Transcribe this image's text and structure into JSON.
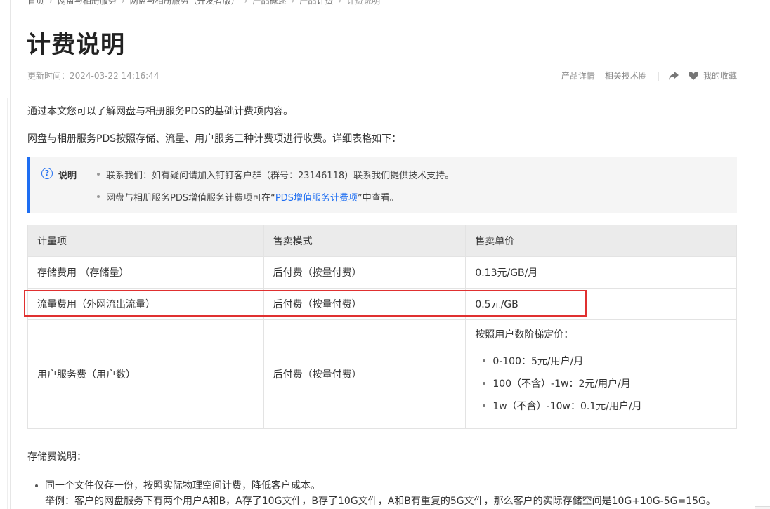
{
  "breadcrumb": {
    "items": [
      "首页",
      "网盘与相册服务",
      "网盘与相册服务（开发者版）",
      "产品概述",
      "产品计费",
      "计费说明"
    ]
  },
  "page": {
    "title": "计费说明",
    "updated": "更新时间：2024-03-22 14:16:44",
    "links": {
      "product_detail": "产品详情",
      "tech_circle": "相关技术圈",
      "favorites": "我的收藏"
    },
    "icons": [
      "share-icon",
      "heart-icon"
    ]
  },
  "intro": {
    "p1": "通过本文您可以了解网盘与相册服务PDS的基础计费项内容。",
    "p2": "网盘与相册服务PDS按照存储、流量、用户服务三种计费项进行收费。详细表格如下："
  },
  "note": {
    "label": "说明",
    "item1": "联系我们：如有疑问请加入钉钉客户群（群号：23146118）联系我们提供技术支持。",
    "item2_prefix": "网盘与相册服务PDS增值服务计费项可在“",
    "item2_link": "PDS增值服务计费项",
    "item2_suffix": "”中查看。"
  },
  "table": {
    "headers": [
      "计量项",
      "售卖模式",
      "售卖单价"
    ],
    "rows": [
      [
        "存储费用 （存储量）",
        "后付费（按量付费）",
        "0.13元/GB/月"
      ],
      [
        "流量费用（外网流出流量）",
        "后付费（按量付费）",
        "0.5元/GB"
      ],
      [
        "用户服务费（用户数）",
        "后付费（按量付费）",
        ""
      ]
    ],
    "tier_title": "按照用户数阶梯定价：",
    "tiers": [
      "0-100：5元/用户/月",
      "100（不含）-1w：2元/用户/月",
      "1w（不含）-10w：0.1元/用户/月"
    ]
  },
  "storage": {
    "heading": "存储费说明：",
    "bullet1": "同一个文件仅存一份，按照实际物理空间计费，降低客户成本。",
    "example": "举例：客户的网盘服务下有两个用户A和B，A存了10G文件，B存了10G文件，A和B有重复的5G文件，那么客户的实际存储空间是10G+10G-5G=15G。"
  },
  "colors": {
    "accent": "#1e6ef2",
    "highlight": "#e03030"
  }
}
